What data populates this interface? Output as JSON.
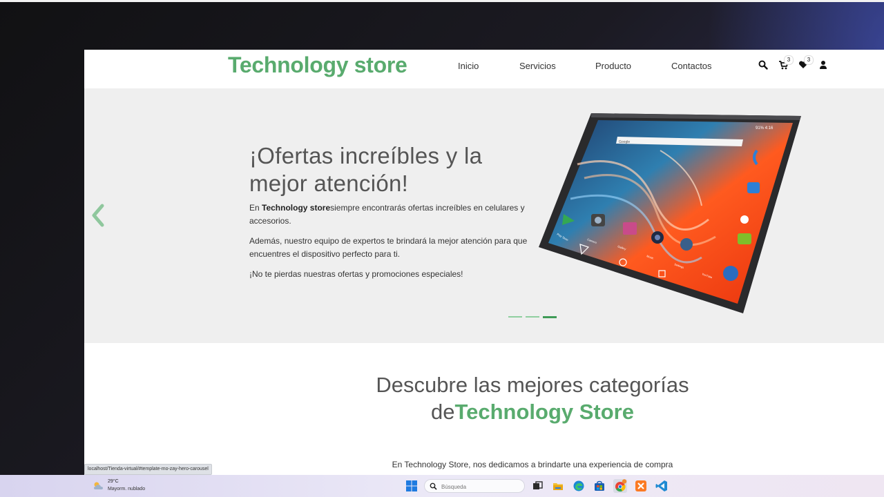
{
  "brand": "Technology store",
  "nav": {
    "links": [
      "Inicio",
      "Servicios",
      "Producto",
      "Contactos"
    ],
    "cart_count": "3",
    "wishlist_count": "3"
  },
  "hero": {
    "title": "¡Ofertas increíbles y la mejor atención!",
    "p1_prefix": "En ",
    "p1_brand": "Technology store",
    "p1_rest": "siempre encontrarás ofertas increíbles en celulares y accesorios.",
    "p2": "Además, nuestro equipo de expertos te brindará la mejor atención para que encuentres el dispositivo perfecto para ti.",
    "p3": "¡No te pierdas nuestras ofertas y promociones especiales!",
    "slides_total": 3,
    "active_slide": 3,
    "tablet_screen": {
      "status": "91% 4:16",
      "search_brand": "Google",
      "app_labels": [
        "Play Store",
        "Camera",
        "Gallery",
        "Music",
        "Settings",
        "YouTube"
      ]
    }
  },
  "categories": {
    "title_prefix": "Descubre las mejores categorías de",
    "title_brand": "Technology Store",
    "subtitle": "En Technology Store, nos dedicamos a brindarte una experiencia de compra"
  },
  "status_url": "localhost/Tienda-virtual/#template-mo-zay-hero-carousel",
  "taskbar": {
    "weather_temp": "29°C",
    "weather_cond": "Mayorm. nublado",
    "search_placeholder": "Búsqueda"
  },
  "colors": {
    "brand_green": "#59ab6e",
    "hero_bg": "#efefef",
    "indicator_active": "#3f9b57"
  }
}
